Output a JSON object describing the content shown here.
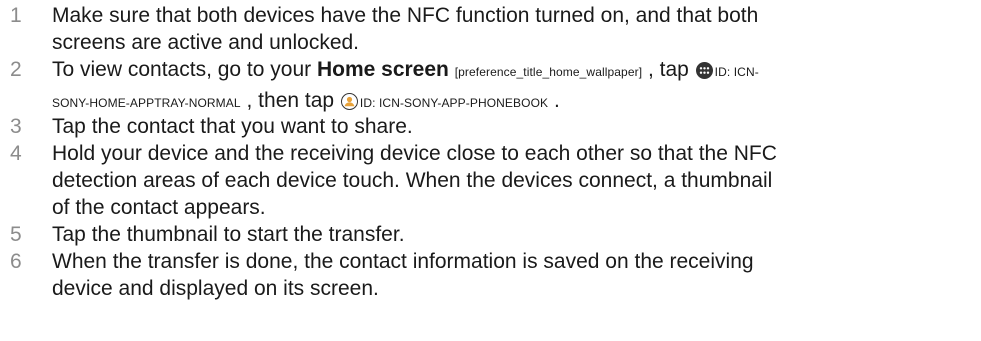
{
  "steps": [
    {
      "number": "1",
      "lines": [
        "Make sure that both devices have the NFC function turned on, and that both",
        "screens are active and unlocked."
      ]
    },
    {
      "number": "2",
      "intro": "To view contacts, go to your ",
      "home_screen": "Home screen",
      "pref_tag": "[preference_title_home_wallpaper]",
      "sep1": " , tap ",
      "apptray_id_a": "ID: ICN-",
      "apptray_id_b": "SONY-HOME-APPTRAY-NORMAL",
      "sep2": " , then tap ",
      "phonebook_id": "ID: ICN-SONY-APP-PHONEBOOK",
      "end": " ."
    },
    {
      "number": "3",
      "lines": [
        "Tap the contact that you want to share."
      ]
    },
    {
      "number": "4",
      "lines": [
        "Hold your device and the receiving device close to each other so that the NFC",
        "detection areas of each device touch. When the devices connect, a thumbnail",
        "of the contact appears."
      ]
    },
    {
      "number": "5",
      "lines": [
        "Tap the thumbnail to start the transfer."
      ]
    },
    {
      "number": "6",
      "lines": [
        "When the transfer is done, the contact information is saved on the receiving",
        "device and displayed on its screen."
      ]
    }
  ],
  "icons": {
    "apptray": "apptray-icon",
    "phonebook": "phonebook-icon"
  },
  "colors": {
    "text": "#1a1a1a",
    "step_number": "#8c8c8c",
    "icon_fill": "#333333",
    "phonebook_fill": "#e8a23a"
  }
}
